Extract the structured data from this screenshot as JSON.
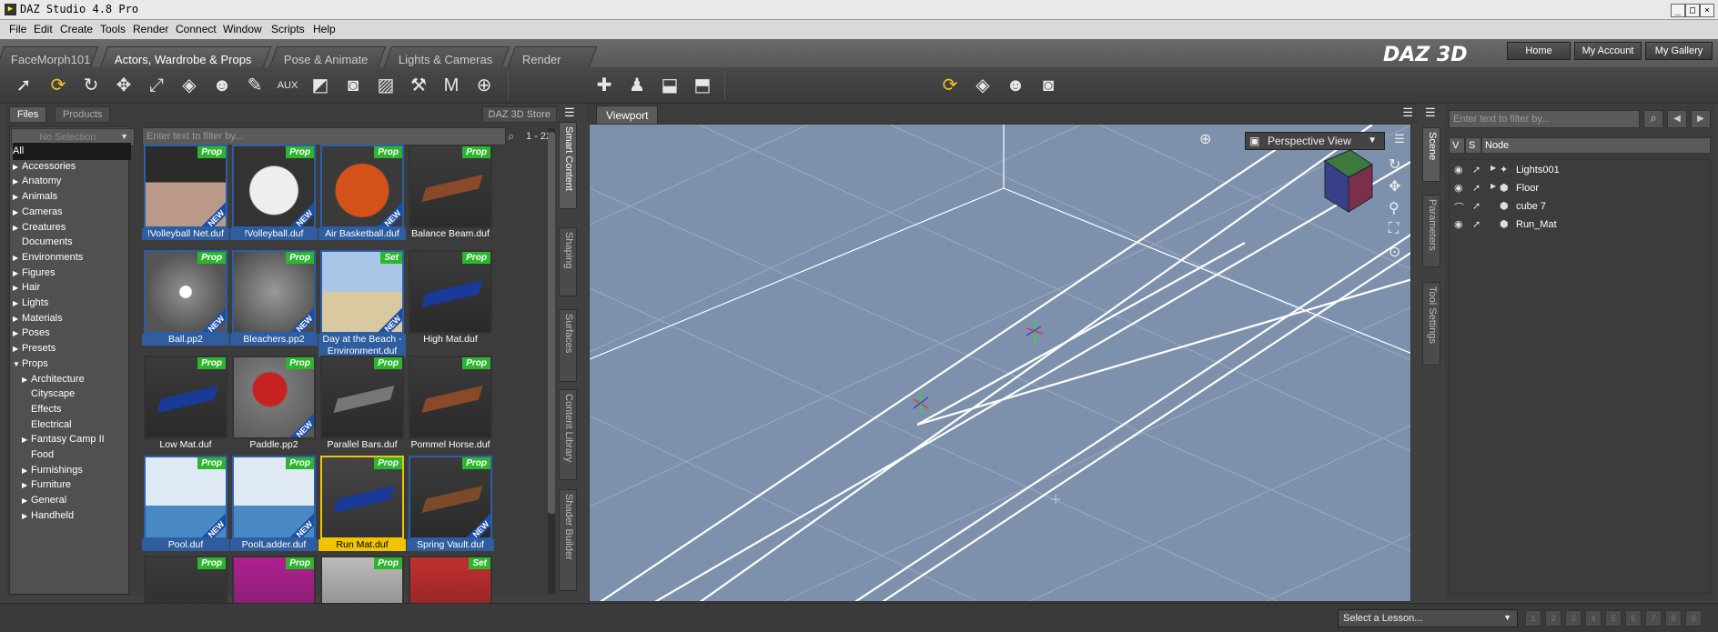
{
  "window": {
    "title": "DAZ Studio 4.8 Pro",
    "min": "_",
    "max": "□",
    "close": "×"
  },
  "menu": [
    "File",
    "Edit",
    "Create",
    "Tools",
    "Render",
    "Connect",
    "Window",
    "Scripts",
    "Help"
  ],
  "tabs": [
    "FaceMorph101",
    "Actors, Wardrobe & Props",
    "Pose & Animate",
    "Lights & Cameras",
    "Render"
  ],
  "brand": "DAZ 3D",
  "top_buttons": [
    "Home",
    "My Account",
    "My Gallery"
  ],
  "left": {
    "tabs": [
      "Files",
      "Products"
    ],
    "store": "DAZ 3D Store",
    "no_selection": "No Selection",
    "filter_placeholder": "Enter text to filter by...",
    "count": "1 - 22",
    "categories": [
      "All",
      "Accessories",
      "Anatomy",
      "Animals",
      "Cameras",
      "Creatures",
      "Documents",
      "Environments",
      "Figures",
      "Hair",
      "Lights",
      "Materials",
      "Poses",
      "Presets",
      "Props",
      "Architecture",
      "Cityscape",
      "Effects",
      "Electrical",
      "Fantasy Camp II",
      "Food",
      "Furnishings",
      "Furniture",
      "General",
      "Handheld"
    ],
    "items": [
      {
        "label": "!Volleyball Net.duf",
        "badge": "Prop",
        "new": true
      },
      {
        "label": "!Volleyball.duf",
        "badge": "Prop",
        "new": true
      },
      {
        "label": "Air Basketball.duf",
        "badge": "Prop",
        "new": true
      },
      {
        "label": "Balance Beam.duf",
        "badge": "Prop",
        "new": false
      },
      {
        "label": "Ball.pp2",
        "badge": "Prop",
        "new": true
      },
      {
        "label": "Bleachers.pp2",
        "badge": "Prop",
        "new": true
      },
      {
        "label": "Day at the Beach - Environment.duf",
        "badge": "Set",
        "new": true
      },
      {
        "label": "High Mat.duf",
        "badge": "Prop",
        "new": false
      },
      {
        "label": "Low Mat.duf",
        "badge": "Prop",
        "new": false
      },
      {
        "label": "Paddle.pp2",
        "badge": "Prop",
        "new": true
      },
      {
        "label": "Parallel Bars.duf",
        "badge": "Prop",
        "new": false
      },
      {
        "label": "Pommel Horse.duf",
        "badge": "Prop",
        "new": false
      },
      {
        "label": "Pool.duf",
        "badge": "Prop",
        "new": true
      },
      {
        "label": "PoolLadder.duf",
        "badge": "Prop",
        "new": true
      },
      {
        "label": "Run Mat.duf",
        "badge": "Prop",
        "new": false
      },
      {
        "label": "Spring Vault.duf",
        "badge": "Prop",
        "new": true
      },
      {
        "label": "",
        "badge": "Prop",
        "new": false
      },
      {
        "label": "",
        "badge": "Prop",
        "new": false
      },
      {
        "label": "",
        "badge": "Prop",
        "new": false
      },
      {
        "label": "",
        "badge": "Set",
        "new": false
      }
    ],
    "side_tabs": [
      "Smart Content",
      "Shaping",
      "Surfaces",
      "Content Library",
      "Shader Builder"
    ]
  },
  "viewport": {
    "tab": "Viewport",
    "view": "Perspective View"
  },
  "scene": {
    "filter_placeholder": "Enter text to filter by...",
    "cols": [
      "V",
      "S",
      "Node"
    ],
    "nodes": [
      "Lights001",
      "Floor",
      "cube 7",
      "Run_Mat"
    ],
    "side_tabs": [
      "Scene",
      "Parameters",
      "Tool Settings"
    ]
  },
  "status": {
    "lesson": "Select a Lesson...",
    "steps": [
      "1",
      "2",
      "3",
      "4",
      "5",
      "6",
      "7",
      "8",
      "9"
    ]
  }
}
